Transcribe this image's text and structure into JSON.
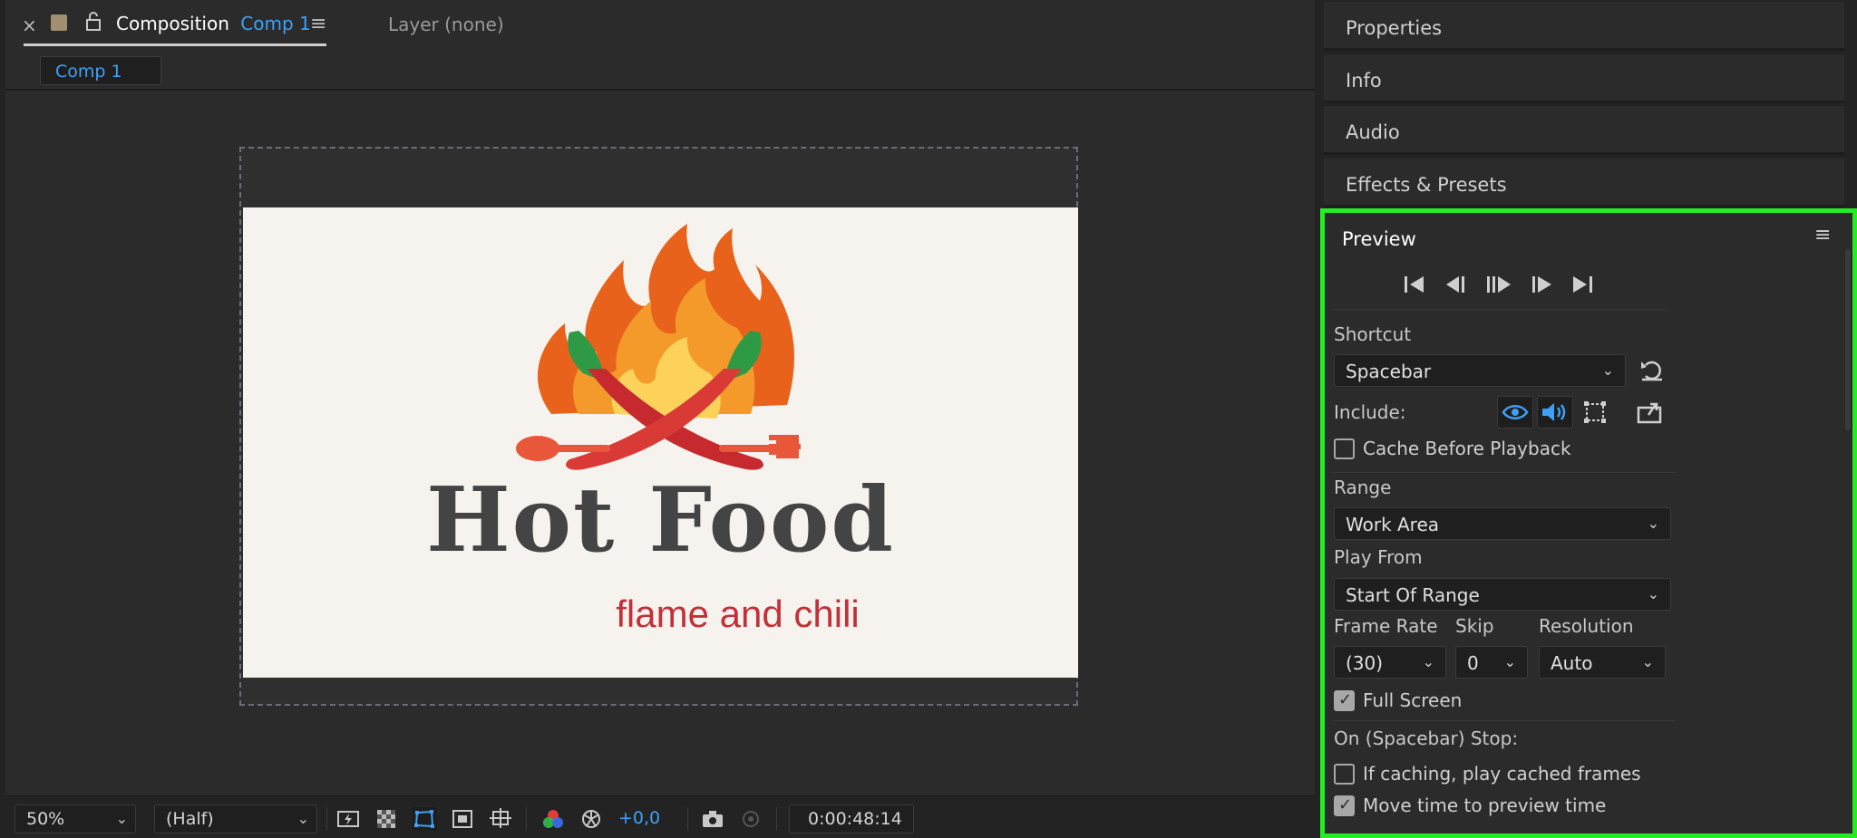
{
  "composition_panel": {
    "close_glyph": "×",
    "tab_title": "Composition",
    "tab_comp_name": "Comp 1",
    "menu_glyph": "≡",
    "layer_tab": "Layer (none)",
    "sub_tab": "Comp 1"
  },
  "canvas": {
    "logo_title": "Hot Food",
    "logo_subtitle": "flame and chili"
  },
  "toolbar": {
    "zoom": "50%",
    "resolution": "(Half)",
    "exposure": "+0,0",
    "timecode": "0:00:48:14",
    "accent_color": "#3fa0f5"
  },
  "right_panels": {
    "properties": "Properties",
    "info": "Info",
    "audio": "Audio",
    "effects_presets": "Effects & Presets"
  },
  "preview": {
    "title": "Preview",
    "menu_glyph": "≡",
    "shortcut_label": "Shortcut",
    "shortcut_value": "Spacebar",
    "include_label": "Include:",
    "cache_before_playback": "Cache Before Playback",
    "cache_before_playback_checked": false,
    "range_label": "Range",
    "range_value": "Work Area",
    "play_from_label": "Play From",
    "play_from_value": "Start Of Range",
    "frame_rate_label": "Frame Rate",
    "frame_rate_value": "(30)",
    "skip_label": "Skip",
    "skip_value": "0",
    "resolution_label": "Resolution",
    "resolution_value": "Auto",
    "full_screen": "Full Screen",
    "full_screen_checked": true,
    "on_stop_label": "On (Spacebar) Stop:",
    "if_caching": "If caching, play cached frames",
    "if_caching_checked": false,
    "move_time": "Move time to preview time",
    "move_time_checked": true,
    "highlight_color": "#22ee22"
  }
}
